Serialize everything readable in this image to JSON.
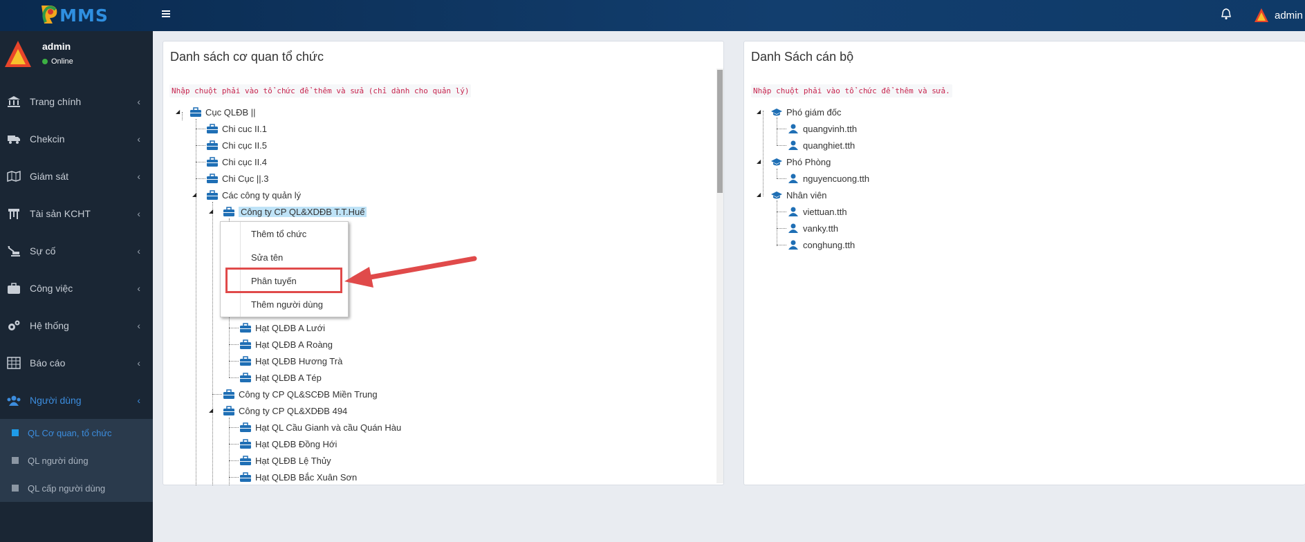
{
  "app": {
    "logo_text": "MMS"
  },
  "header": {
    "user": "admin"
  },
  "sidebar": {
    "user": {
      "name": "admin",
      "status": "Online"
    },
    "items": [
      {
        "label": "Trang chính",
        "icon": "bank-icon"
      },
      {
        "label": "Chekcin",
        "icon": "truck-icon"
      },
      {
        "label": "Giám sát",
        "icon": "map-icon"
      },
      {
        "label": "Tài sản KCHT",
        "icon": "signpost-icon"
      },
      {
        "label": "Sự cố",
        "icon": "excavator-icon"
      },
      {
        "label": "Công việc",
        "icon": "briefcase-icon"
      },
      {
        "label": "Hệ thống",
        "icon": "gears-icon"
      },
      {
        "label": "Báo cáo",
        "icon": "table-icon"
      },
      {
        "label": "Người dùng",
        "icon": "users-icon"
      }
    ],
    "subitems": [
      {
        "label": "QL Cơ quan, tổ chức"
      },
      {
        "label": "QL người dùng"
      },
      {
        "label": "QL cấp người dùng"
      }
    ]
  },
  "org_panel": {
    "title": "Danh sách cơ quan tổ chức",
    "hint": "Nhập chuột phải vào tổ chức để thêm và sửa (chỉ dành cho quản lý)",
    "root": "Cục QLĐB ||",
    "nodes": [
      "Chi cuc II.1",
      "Chi cục II.5",
      "Chi cục II.4",
      "Chi Cục ||.3",
      "Các công ty quản lý",
      "Công ty CP QL&XDĐB T.T.Huế",
      "Hạt QLĐB A Lưới",
      "Hạt QLĐB A Roàng",
      "Hạt QLĐB Hương Trà",
      "Hạt QLĐB A Tép",
      "Công ty CP QL&SCĐB Miền Trung",
      "Công ty CP QL&XDĐB 494",
      "Hạt QL Cầu Gianh và cầu Quán Hàu",
      "Hạt QLĐB Đồng Hới",
      "Hạt QLĐB Lệ Thủy",
      "Hạt QLĐB Bắc Xuân Sơn"
    ]
  },
  "context_menu": {
    "items": [
      "Thêm tổ chức",
      "Sửa tên",
      "Phân tuyến",
      "Thêm người dùng"
    ]
  },
  "staff_panel": {
    "title": "Danh Sách cán bộ",
    "hint": "Nhập chuột phải vào tổ chức để thêm và sửa.",
    "groups": [
      {
        "label": "Phó giám đốc",
        "members": [
          "quangvinh.tth",
          "quanghiet.tth"
        ]
      },
      {
        "label": "Phó Phòng",
        "members": [
          "nguyencuong.tth"
        ]
      },
      {
        "label": "Nhân viên",
        "members": [
          "viettuan.tth",
          "vanky.tth",
          "conghung.tth"
        ]
      }
    ]
  },
  "colors": {
    "accent": "#3c8dde",
    "sidebar": "#1a2634",
    "highlight": "#e04a4a"
  }
}
